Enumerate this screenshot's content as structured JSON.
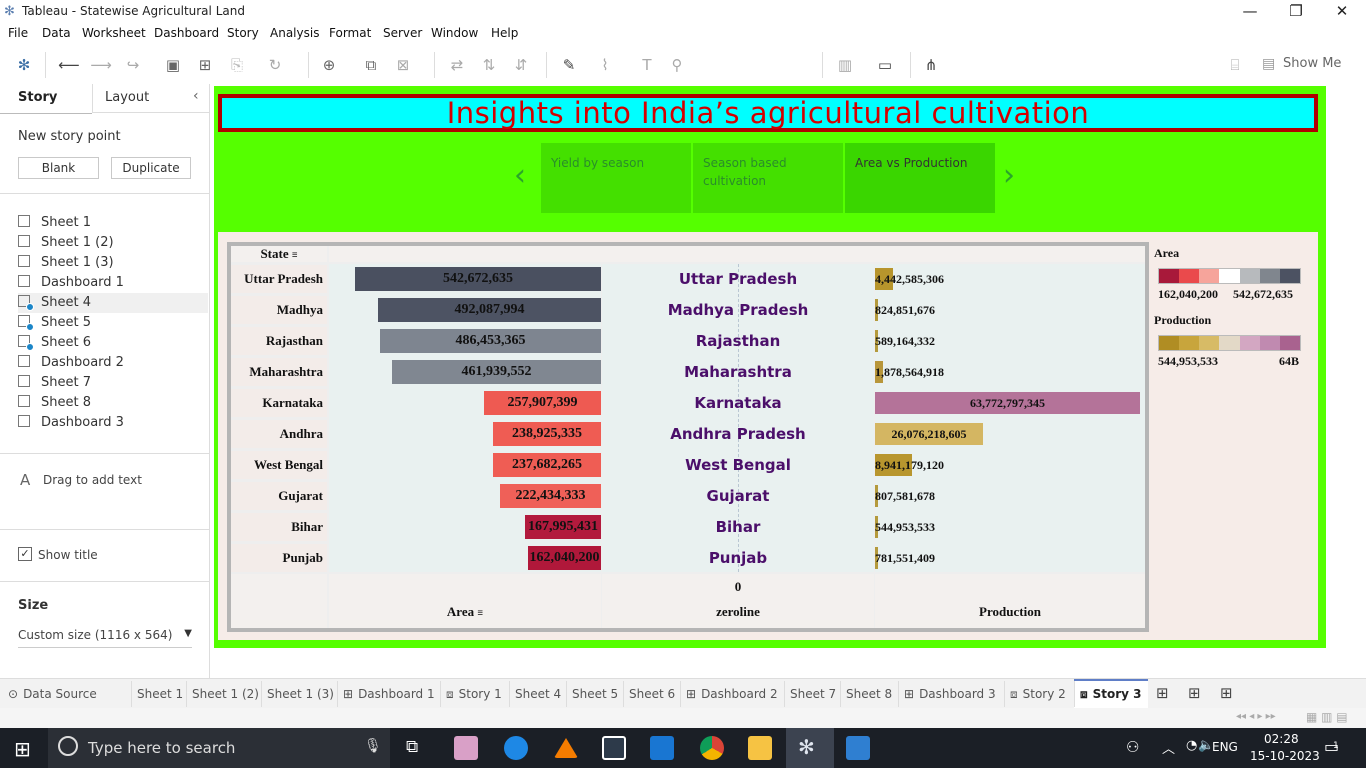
{
  "window": {
    "title": "Tableau - Statewise Agricultural Land"
  },
  "menu": [
    "File",
    "Data",
    "Worksheet",
    "Dashboard",
    "Story",
    "Analysis",
    "Format",
    "Server",
    "Window",
    "Help"
  ],
  "toolbar": {
    "show_me": "Show Me"
  },
  "side_panel": {
    "tab_story": "Story",
    "tab_layout": "Layout",
    "new_story_point": "New story point",
    "blank_btn": "Blank",
    "duplicate_btn": "Duplicate",
    "sheets": [
      "Sheet 1",
      "Sheet 1 (2)",
      "Sheet 1 (3)",
      "Dashboard 1",
      "Sheet 4",
      "Sheet 5",
      "Sheet 6",
      "Dashboard 2",
      "Sheet 7",
      "Sheet 8",
      "Dashboard 3"
    ],
    "drag_text": "Drag to add text",
    "show_title": "Show title",
    "size_label": "Size",
    "size_value": "Custom size (1116 x 564)"
  },
  "story": {
    "title": "Insights into India’s agricultural cultivation",
    "points": [
      "Yield by season",
      "Season based cultivation",
      "Area vs Production"
    ]
  },
  "chart_data": {
    "type": "bar",
    "states": [
      "Uttar Pradesh",
      "Madhya Pradesh",
      "Rajasthan",
      "Maharashtra",
      "Karnataka",
      "Andhra Pradesh",
      "West Bengal",
      "Gujarat",
      "Bihar",
      "Punjab"
    ],
    "area_labels": [
      "542,672,635",
      "492,087,994",
      "486,453,365",
      "461,939,552",
      "257,907,399",
      "238,925,335",
      "237,682,265",
      "222,434,333",
      "167,995,431",
      "162,040,200"
    ],
    "area_values": [
      542672635,
      492087994,
      486453365,
      461939552,
      257907399,
      238925335,
      237682265,
      222434333,
      167995431,
      162040200
    ],
    "area_colors": [
      "#4a5060",
      "#4d5363",
      "#7e8590",
      "#808791",
      "#ee5a52",
      "#ef5c53",
      "#ef5d54",
      "#ef6058",
      "#b21a3d",
      "#b0183a"
    ],
    "production_labels": [
      "4,442,585,306",
      "824,851,676",
      "589,164,332",
      "1,878,564,918",
      "63,772,797,345",
      "26,076,218,605",
      "8,941,179,120",
      "807,581,678",
      "544,953,533",
      "781,551,409"
    ],
    "production_values": [
      4442585306,
      824851676,
      589164332,
      1878564918,
      63772797345,
      26076218605,
      8941179120,
      807581678,
      544953533,
      781551409
    ],
    "production_colors": [
      "#b7952c",
      "#b49a3c",
      "#b49a3c",
      "#b8963a",
      "#b47399",
      "#d4b662",
      "#b8962e",
      "#b49a3c",
      "#b49a3c",
      "#b49a3c"
    ],
    "state_header": "State",
    "xlabel_area": "Area",
    "xlabel_zero": "zeroline",
    "zero_tick": "0",
    "xlabel_production": "Production"
  },
  "legend": {
    "area_title": "Area",
    "area_min": "162,040,200",
    "area_max": "542,672,635",
    "area_colors": [
      "#a8193a",
      "#ea4a4c",
      "#f6a49b",
      "#ffffff",
      "#b7babd",
      "#80868e",
      "#4c5262"
    ],
    "prod_title": "Production",
    "prod_min": "544,953,533",
    "prod_max": "64B",
    "prod_colors": [
      "#b08d23",
      "#c8a53c",
      "#d7bb66",
      "#e3d9c7",
      "#d3a7c2",
      "#c08ab0",
      "#a9628f"
    ]
  },
  "tabs": [
    "Data Source",
    "Sheet 1",
    "Sheet 1 (2)",
    "Sheet 1 (3)",
    "Dashboard 1",
    "Story 1",
    "Sheet 4",
    "Sheet 5",
    "Sheet 6",
    "Dashboard 2",
    "Sheet 7",
    "Sheet 8",
    "Dashboard 3",
    "Story 2",
    "Story 3"
  ],
  "taskbar": {
    "search": "Type here to search",
    "lang": "ENG",
    "time": "02:28",
    "date": "15-10-2023",
    "notif": "1"
  }
}
